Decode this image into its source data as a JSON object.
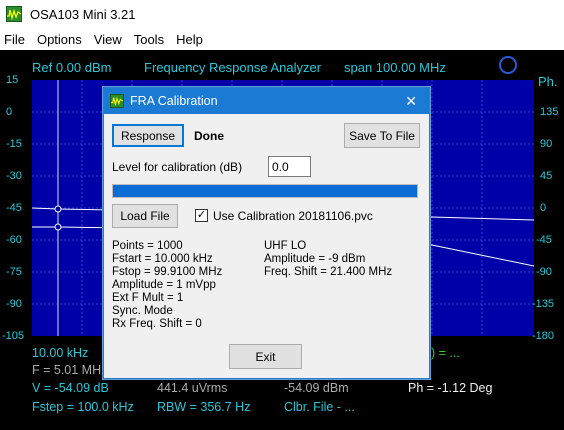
{
  "app": {
    "title": "OSA103 Mini 3.21"
  },
  "menu": [
    "File",
    "Options",
    "View",
    "Tools",
    "Help"
  ],
  "plot_header": {
    "ref": "Ref  0.00 dBm",
    "mode": "Frequency Response Analyzer",
    "span": "span 100.00 MHz"
  },
  "y_left": [
    "15",
    "0",
    "-15",
    "-30",
    "-45",
    "-60",
    "-75",
    "-90",
    "-105"
  ],
  "y_right_title": "Ph.",
  "y_right": [
    "135",
    "90",
    "45",
    "0",
    "-45",
    "-90",
    "-135",
    "-180"
  ],
  "bottom": {
    "freq": "10.00 kHz",
    "f_label": "F = 5.01 MH",
    "marker_tail": "1) = ...",
    "v": "V = -54.09 dB",
    "uvrms": "441.4 uVrms",
    "dbm": "-54.09 dBm",
    "ph": "Ph = -1.12 Deg",
    "fstep": "Fstep = 100.0 kHz",
    "rbw": "RBW = 356.7 Hz",
    "clbr": "Clbr. File - ..."
  },
  "dialog": {
    "title": "FRA Calibration",
    "response_button": "Response",
    "status": "Done",
    "save_button": "Save To File",
    "level_label": "Level for calibration (dB)",
    "level_value": "0.0",
    "progress": 1.0,
    "load_button": "Load File",
    "use_cal_checked": true,
    "use_cal_label": "Use Calibration 20181106.pvc",
    "left_info": [
      "Points = 1000",
      "Fstart = 10.000 kHz",
      "Fstop = 99.9100 MHz",
      "Amplitude = 1 mVpp",
      "Ext F Mult = 1",
      "Sync. Mode",
      "Rx Freq. Shift = 0"
    ],
    "right_info": [
      "UHF LO",
      "Amplitude = -9 dBm",
      "Freq. Shift = 21.400 MHz"
    ],
    "exit_button": "Exit"
  },
  "colors": {
    "cyan": "#27c8d8",
    "grid": "#0000a8",
    "dialog_accent": "#1a7ad4",
    "progress": "#0a6cd4"
  }
}
